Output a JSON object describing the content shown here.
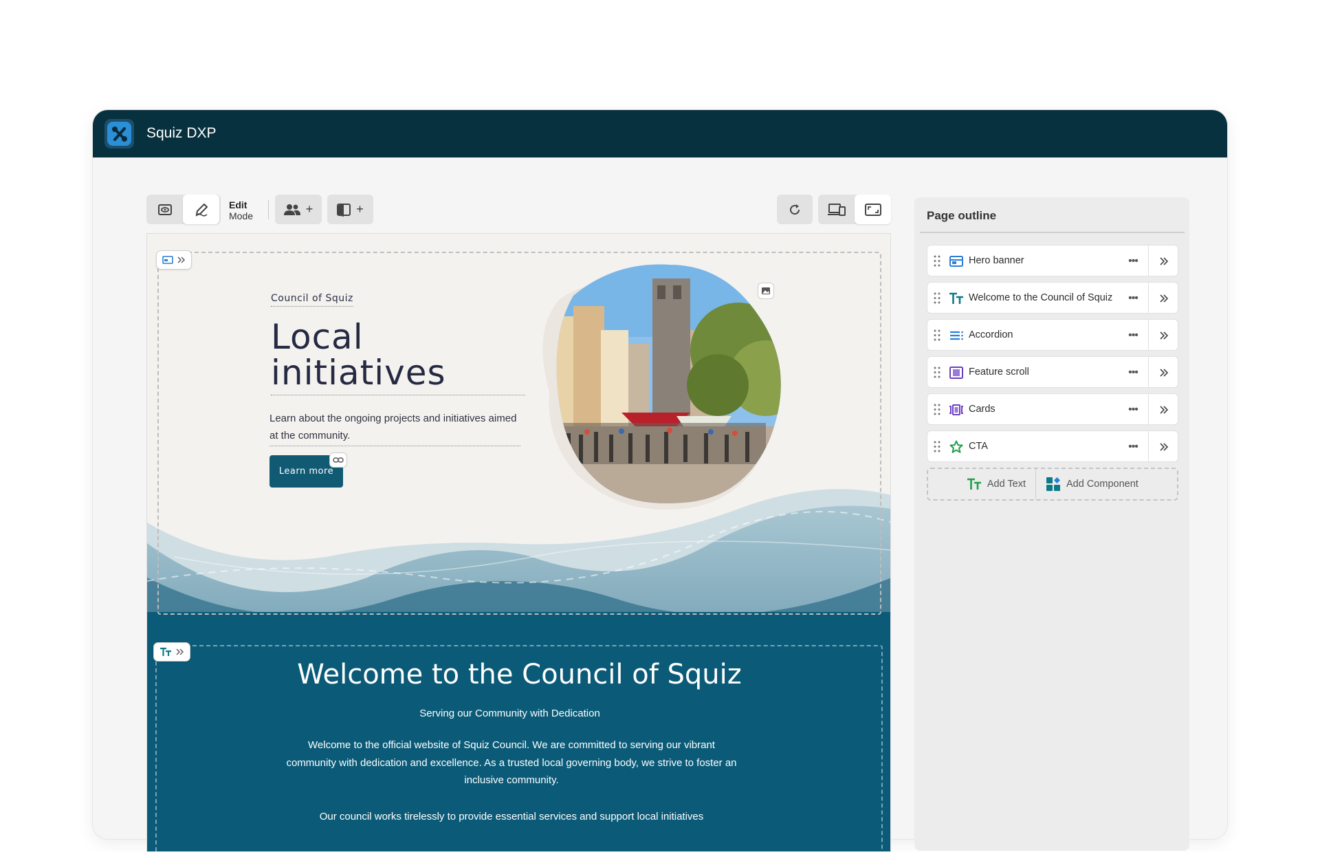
{
  "app": {
    "title": "Squiz DXP"
  },
  "toolbar": {
    "mode_title": "Edit",
    "mode_sub": "Mode",
    "add_symbol": "+"
  },
  "hero": {
    "eyebrow": "Council of Squiz",
    "title": "Local initiatives",
    "description": "Learn about the ongoing projects and initiatives aimed at the community.",
    "button_label": "Learn more"
  },
  "welcome": {
    "title": "Welcome to the Council of Squiz",
    "subtitle": "Serving our Community with Dedication",
    "paragraph1": "Welcome to the official website of Squiz Council. We are committed to serving our vibrant community with dedication and excellence. As a trusted local governing body, we strive to foster an inclusive community.",
    "paragraph2": "Our council works tirelessly to provide essential services and support local initiatives"
  },
  "outline": {
    "title": "Page outline",
    "items": [
      {
        "label": "Hero banner",
        "icon": "hero-banner-icon",
        "color": "#2a7fd4"
      },
      {
        "label": "Welcome to the Council of Squiz",
        "icon": "text-icon",
        "color": "#0d7a8a"
      },
      {
        "label": "Accordion",
        "icon": "accordion-icon",
        "color": "#2a7fd4"
      },
      {
        "label": "Feature scroll",
        "icon": "feature-scroll-icon",
        "color": "#6a3fc1"
      },
      {
        "label": "Cards",
        "icon": "cards-icon",
        "color": "#6a3fc1"
      },
      {
        "label": "CTA",
        "icon": "star-icon",
        "color": "#1f9e4a"
      }
    ],
    "add_text_label": "Add Text",
    "add_component_label": "Add Component"
  },
  "colors": {
    "titlebar": "#07313f",
    "brand_teal": "#105a74",
    "welcome_bg": "#0b5b78"
  }
}
